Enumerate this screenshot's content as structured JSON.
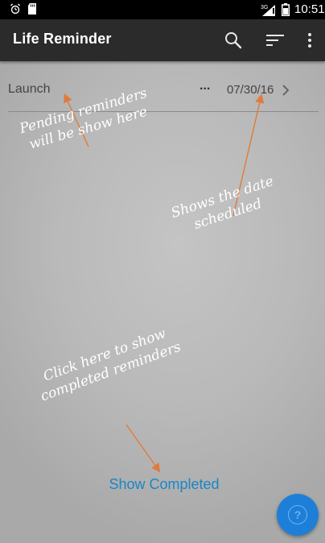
{
  "status_bar": {
    "time": "10:51",
    "network": "3G",
    "icons": [
      "alarm-icon",
      "sd-card-icon",
      "signal-icon",
      "battery-icon"
    ]
  },
  "app_bar": {
    "title": "Life Reminder",
    "actions": [
      "search-icon",
      "sort-icon",
      "overflow-menu-icon"
    ]
  },
  "reminders": [
    {
      "title": "Launch",
      "more": "...",
      "date": "07/30/16"
    }
  ],
  "annotations": {
    "pending": "Pending reminders\nwill be show here",
    "date": "Shows the date\nscheduled",
    "completed": "Click here to show\ncompleted reminders"
  },
  "show_completed_label": "Show Completed",
  "fab": {
    "label": "?",
    "icon": "help-icon"
  },
  "colors": {
    "status_bar": "#000000",
    "app_bar": "#2b2b2b",
    "accent": "#1a86c8",
    "fab": "#1e7fd8",
    "arrow": "#e07b3a"
  }
}
